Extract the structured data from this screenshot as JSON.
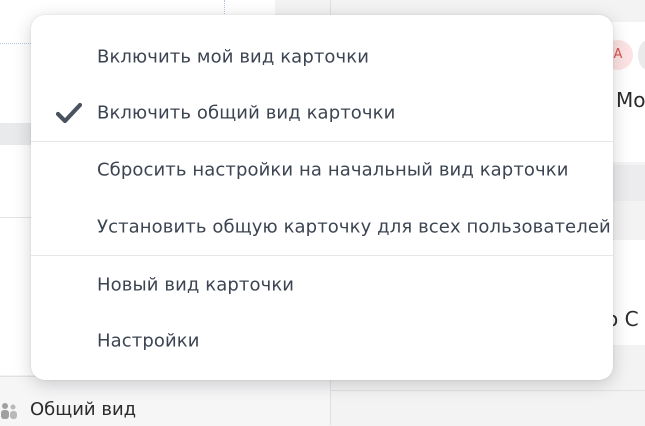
{
  "context_menu": {
    "items": [
      {
        "label": "Включить мой вид карточки",
        "checked": false
      },
      {
        "label": "Включить общий вид карточки",
        "checked": true
      },
      {
        "label": "Сбросить настройки на начальный вид карточки",
        "checked": false
      },
      {
        "label": "Установить общую карточку для всех пользователей",
        "checked": false
      },
      {
        "label": "Новый вид карточки",
        "checked": false
      },
      {
        "label": "Настройки",
        "checked": false
      }
    ],
    "check_icon": "checkmark-icon"
  },
  "background": {
    "avatar_initial": "А",
    "fragment_top": "Мо",
    "fragment_bottom": "о С",
    "footer_label": "Общий вид",
    "footer_icon": "users-icon"
  },
  "colors": {
    "menu_text": "#3c4452",
    "check": "#4a5260",
    "avatar_bg": "#fde3e3",
    "avatar_text": "#d9534f"
  }
}
